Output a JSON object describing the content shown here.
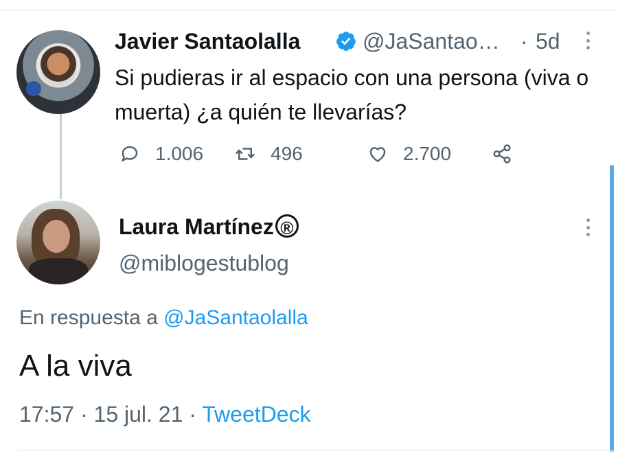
{
  "tweet": {
    "author_name": "Javier Santaolalla",
    "handle": "@JaSantao…",
    "separator": "·",
    "time_ago": "5d",
    "text": "Si pudieras ir al espacio con una persona (viva o muerta) ¿a quién te llevarías?",
    "replies": "1.006",
    "retweets": "496",
    "likes": "2.700"
  },
  "reply": {
    "author_name": "Laura Martínez",
    "registered_mark": "®",
    "handle": "@miblogestublog",
    "in_reply_prefix": "En respuesta a",
    "in_reply_mention": "@JaSantaolalla",
    "text": "A la viva",
    "time": "17:57",
    "date": "15 jul. 21",
    "meta_sep": "·",
    "source": "TweetDeck"
  },
  "colors": {
    "accent": "#1d9bf0",
    "muted_text": "#536471",
    "text": "#0f1419",
    "scrollbar": "#5aa9e6"
  },
  "icons": [
    "verified-badge-icon",
    "more-icon",
    "reply-icon",
    "retweet-icon",
    "like-icon",
    "share-icon"
  ]
}
